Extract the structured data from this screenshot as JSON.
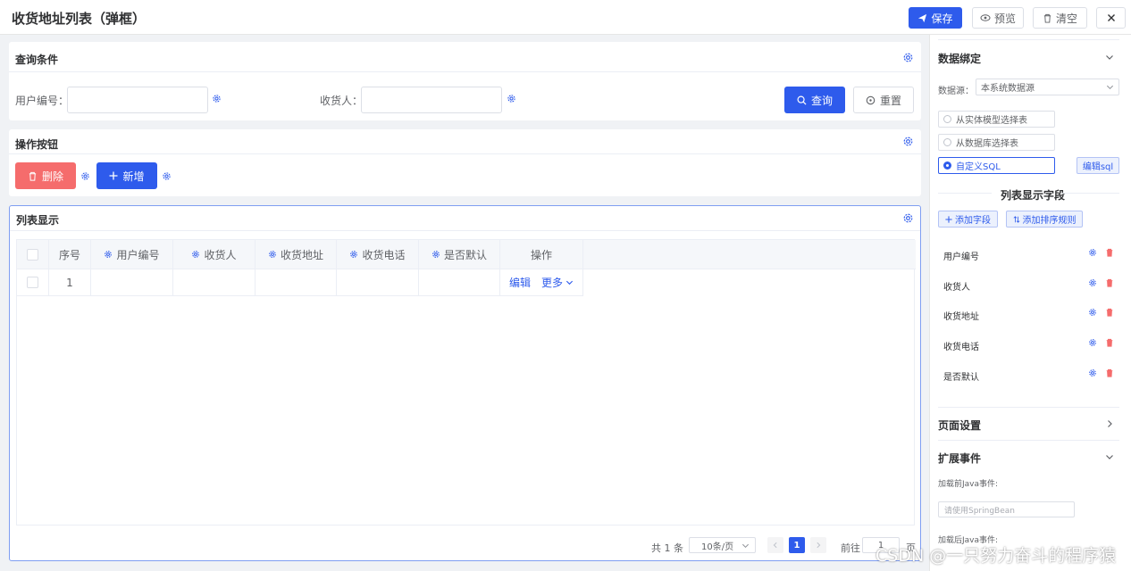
{
  "header": {
    "title": "收货地址列表（弹框）",
    "save_label": "保存",
    "preview_label": "预览",
    "clear_label": "清空"
  },
  "query_panel": {
    "title": "查询条件",
    "fields": [
      {
        "label": "用户编号：",
        "value": ""
      },
      {
        "label": "收货人：",
        "value": ""
      }
    ],
    "search_label": "查询",
    "reset_label": "重置"
  },
  "action_panel": {
    "title": "操作按钮",
    "delete_label": "删除",
    "add_label": "新增"
  },
  "list_panel": {
    "title": "列表显示",
    "columns": [
      "序号",
      "用户编号",
      "收货人",
      "收货地址",
      "收货电话",
      "是否默认",
      "操作"
    ],
    "rows": [
      {
        "index": "1",
        "edit": "编辑",
        "more": "更多"
      }
    ]
  },
  "pagination": {
    "total": "共 1 条",
    "page_size": "10条/页",
    "current_page": "1",
    "goto_label": "前往",
    "goto_value": "1",
    "page_suffix": "页"
  },
  "sidebar": {
    "data_binding": {
      "title": "数据绑定",
      "datasource_label": "数据源：",
      "datasource_value": "本系统数据源",
      "options": [
        "从实体模型选择表",
        "从数据库选择表",
        "自定义SQL"
      ],
      "selected_option": "自定义SQL",
      "edit_sql_label": "编辑sql"
    },
    "fields_section": {
      "title": "列表显示字段",
      "add_field_label": "添加字段",
      "add_sort_label": "添加排序规则",
      "fields": [
        "用户编号",
        "收货人",
        "收货地址",
        "收货电话",
        "是否默认"
      ]
    },
    "page_settings": {
      "title": "页面设置"
    },
    "extend_events": {
      "title": "扩展事件",
      "before_label": "加载前Java事件:",
      "before_placeholder": "请使用SpringBean",
      "after_label": "加载后Java事件:"
    }
  },
  "watermark": "CSDN @一只努力奋斗的程序猿",
  "colors": {
    "primary": "#2e5bec",
    "danger": "#f56c6c",
    "text": "#303133",
    "muted": "#606266"
  }
}
